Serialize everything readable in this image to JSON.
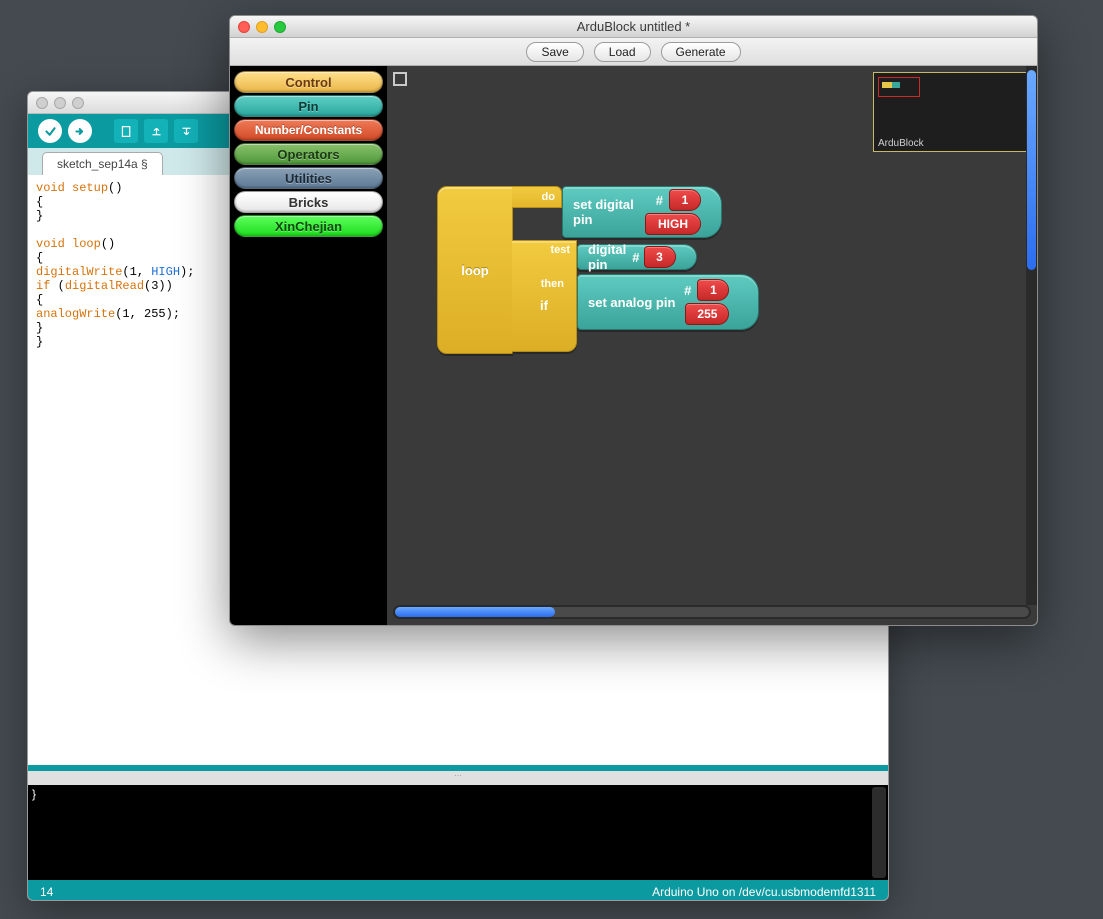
{
  "arduino": {
    "tab": "sketch_sep14a §",
    "code": {
      "l1a": "void",
      "l1b": " setup",
      "l1c": "()",
      "l2": "{",
      "l3": "}",
      "l4": "",
      "l5a": "void",
      "l5b": " loop",
      "l5c": "()",
      "l6": "{",
      "l7a": "digitalWrite",
      "l7b": "(1, ",
      "l7c": "HIGH",
      "l7d": ");",
      "l8a": "if",
      "l8b": " (",
      "l8c": "digitalRead",
      "l8d": "(3))",
      "l9": "{",
      "l10a": "analogWrite",
      "l10b": "(1, 255);",
      "l11": "}",
      "l12": "}"
    },
    "status_left": "14",
    "status_right": "Arduino Uno on /dev/cu.usbmodemfd1311"
  },
  "ardublock": {
    "title": "ArduBlock untitled *",
    "toolbar": {
      "save": "Save",
      "load": "Load",
      "generate": "Generate"
    },
    "palette": {
      "control": "Control",
      "pin": "Pin",
      "numconst": "Number/Constants",
      "operators": "Operators",
      "utilities": "Utilities",
      "bricks": "Bricks",
      "xinchejian": "XinChejian"
    },
    "minimap_label": "ArduBlock",
    "blocks": {
      "loop": "loop",
      "do": "do",
      "if": "if",
      "test": "test",
      "then": "then",
      "set_digital_pin": "set digital pin",
      "digital_pin": "digital pin",
      "set_analog_pin": "set analog pin",
      "hash": "#",
      "pin1": "1",
      "high": "HIGH",
      "pin3": "3",
      "pin1b": "1",
      "val255": "255"
    }
  }
}
